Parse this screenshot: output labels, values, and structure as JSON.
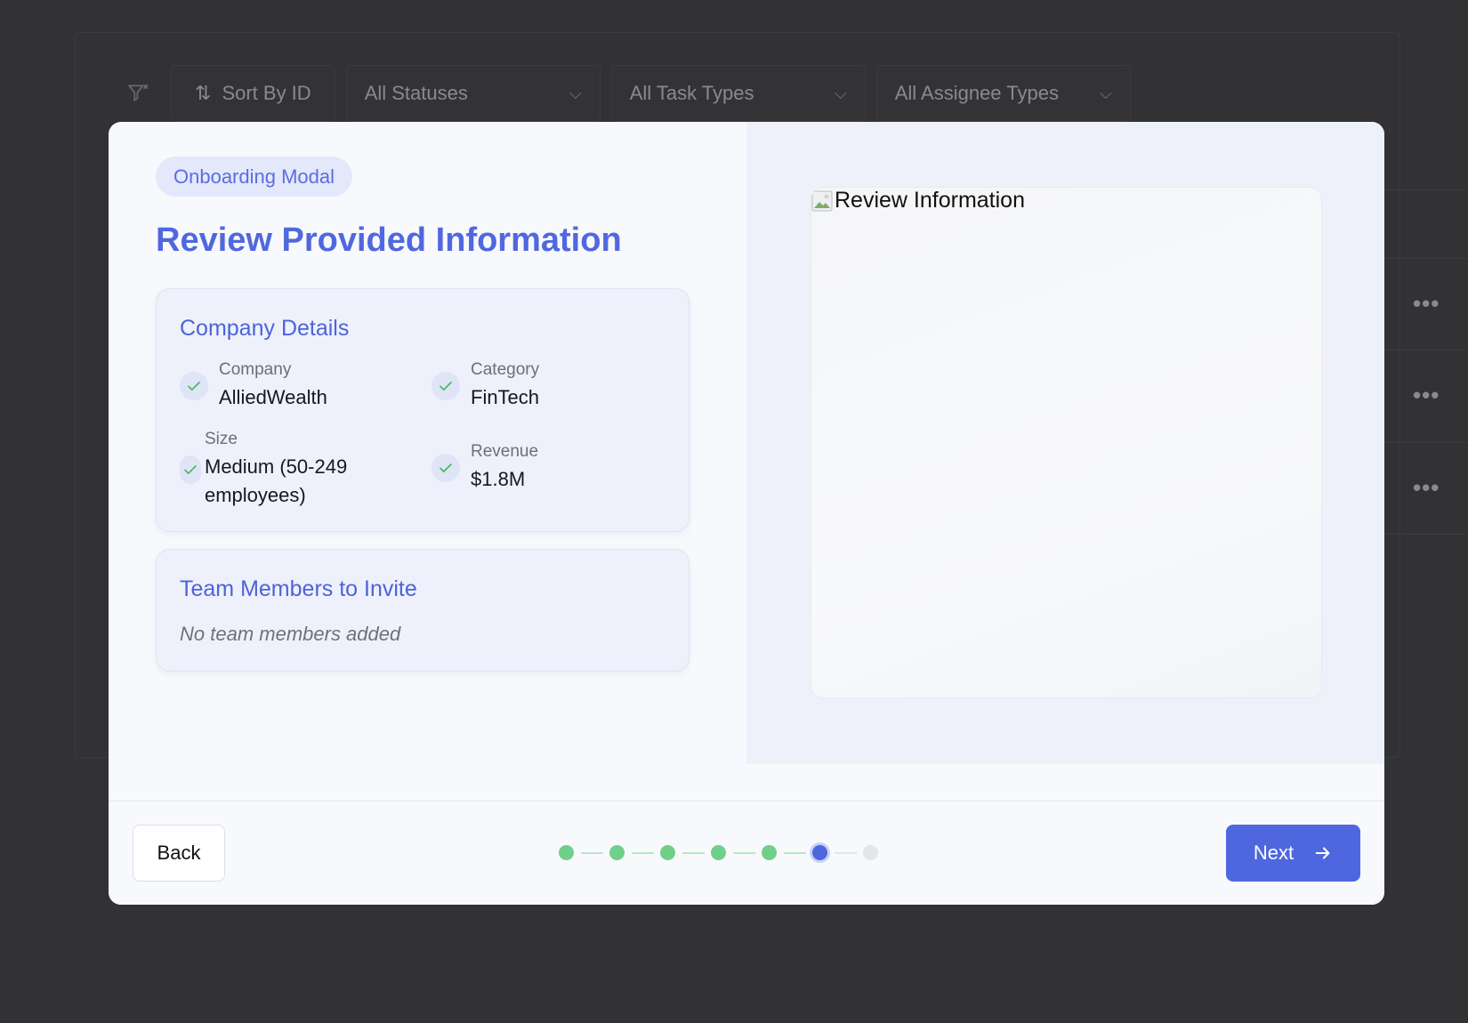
{
  "background": {
    "toolbar": {
      "sort_label": "Sort By ID",
      "status_filter": "All Statuses",
      "task_type_filter": "All Task Types",
      "assignee_type_filter": "All Assignee Types"
    },
    "row_menu": "•••"
  },
  "modal": {
    "badge": "Onboarding Modal",
    "title": "Review Provided Information",
    "company_details": {
      "heading": "Company Details",
      "company_label": "Company",
      "company_value": "AlliedWealth",
      "category_label": "Category",
      "category_value": "FinTech",
      "size_label": "Size",
      "size_value": "Medium (50-249 employees)",
      "revenue_label": "Revenue",
      "revenue_value": "$1.8M"
    },
    "team": {
      "heading": "Team Members to Invite",
      "empty_text": "No team members added"
    },
    "image_alt": "Review Information",
    "footer": {
      "back_label": "Back",
      "next_label": "Next",
      "steps": [
        "done",
        "done",
        "done",
        "done",
        "done",
        "current",
        "todo"
      ]
    }
  },
  "colors": {
    "accent": "#4e67df",
    "success": "#6fd089",
    "backdrop": "#323234"
  }
}
